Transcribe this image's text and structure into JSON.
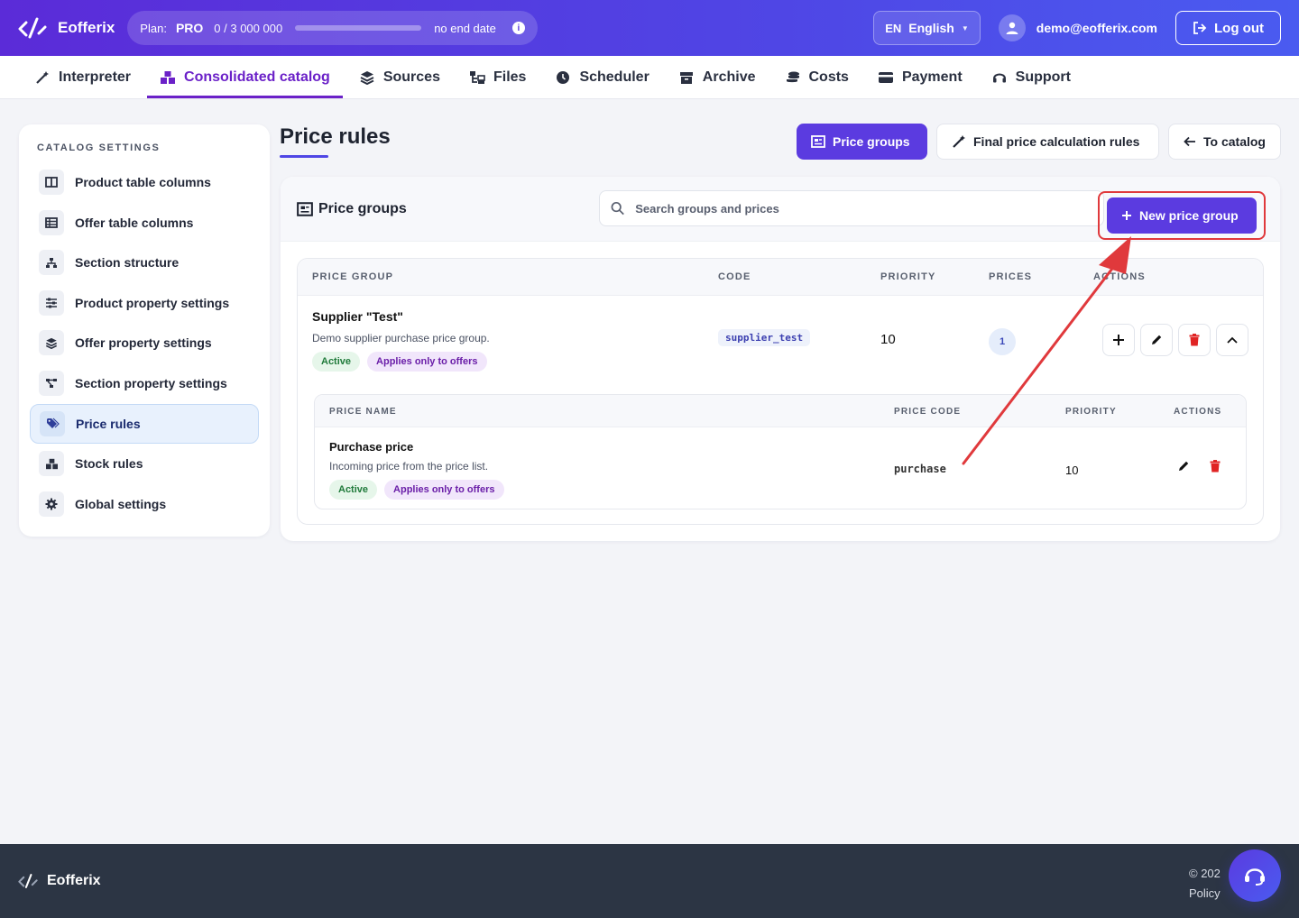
{
  "app": {
    "name": "Eofferix",
    "plan_label": "Plan:",
    "plan_tier": "PRO",
    "plan_usage": "0 / 3 000 000",
    "plan_used_fraction": 0.0,
    "plan_end": "no end date",
    "info_icon": "info-icon"
  },
  "header": {
    "lang_code": "EN",
    "lang_name": "English",
    "user_email": "demo@eofferix.com",
    "logout_label": "Log out"
  },
  "nav": {
    "items": [
      {
        "label": "Interpreter",
        "icon": "magic-wand-icon"
      },
      {
        "label": "Consolidated catalog",
        "icon": "boxes-icon",
        "active": true
      },
      {
        "label": "Sources",
        "icon": "layers-icon"
      },
      {
        "label": "Files",
        "icon": "folder-tree-icon"
      },
      {
        "label": "Scheduler",
        "icon": "clock-icon"
      },
      {
        "label": "Archive",
        "icon": "archive-icon"
      },
      {
        "label": "Costs",
        "icon": "coins-icon"
      },
      {
        "label": "Payment",
        "icon": "credit-card-icon"
      },
      {
        "label": "Support",
        "icon": "headset-icon"
      }
    ]
  },
  "sidebar": {
    "heading": "CATALOG SETTINGS",
    "items": [
      {
        "label": "Product table columns",
        "icon": "columns-icon"
      },
      {
        "label": "Offer table columns",
        "icon": "table-icon"
      },
      {
        "label": "Section structure",
        "icon": "sitemap-icon"
      },
      {
        "label": "Product property settings",
        "icon": "sliders-icon"
      },
      {
        "label": "Offer property settings",
        "icon": "layers-icon"
      },
      {
        "label": "Section property settings",
        "icon": "diagram-icon"
      },
      {
        "label": "Price rules",
        "icon": "tags-icon",
        "active": true
      },
      {
        "label": "Stock rules",
        "icon": "boxes-icon"
      },
      {
        "label": "Global settings",
        "icon": "gear-icon"
      }
    ]
  },
  "page": {
    "title": "Price rules",
    "btn_price_groups": "Price groups",
    "btn_final_rules": "Final price calculation rules",
    "btn_to_catalog": "To catalog"
  },
  "card": {
    "title": "Price groups",
    "search_placeholder": "Search groups and prices",
    "new_button": "New price group",
    "columns": {
      "group": "PRICE GROUP",
      "code": "CODE",
      "priority": "PRIORITY",
      "prices": "PRICES",
      "actions": "ACTIONS"
    },
    "groups": [
      {
        "name": "Supplier \"Test\"",
        "description": "Demo supplier purchase price group.",
        "status": "Active",
        "scope": "Applies only to offers",
        "code": "supplier_test",
        "priority": "10",
        "prices_count": "1",
        "sub_columns": {
          "name": "PRICE NAME",
          "code": "PRICE CODE",
          "priority": "PRIORITY",
          "actions": "ACTIONS"
        },
        "prices": [
          {
            "name": "Purchase price",
            "description": "Incoming price from the price list.",
            "status": "Active",
            "scope": "Applies only to offers",
            "code": "purchase",
            "priority": "10"
          }
        ]
      }
    ]
  },
  "footer": {
    "brand": "Eofferix",
    "copyright": "© 202",
    "policy": "Policy"
  },
  "colors": {
    "brand_gradient_start": "#5b2bd8",
    "brand_gradient_end": "#4a5bf0",
    "accent": "#5b3be0",
    "nav_active": "#6b21c8",
    "annotation_red": "#e0393c"
  }
}
